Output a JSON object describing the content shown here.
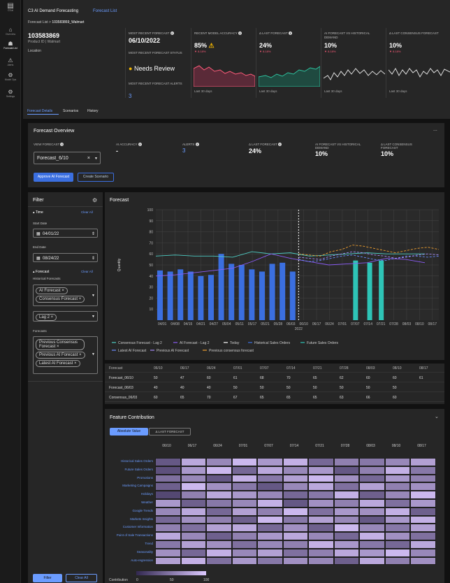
{
  "app": {
    "logo_text": "C3.ai",
    "title": "C3 AI Demand Forecasting",
    "tab_link": "Forecast List"
  },
  "nav": [
    {
      "label": "Overview",
      "icon": "home-icon",
      "glyph": "⌂"
    },
    {
      "label": "Forecast List",
      "icon": "people-icon",
      "glyph": "☗"
    },
    {
      "label": "Alerts",
      "icon": "alert-icon",
      "glyph": "⚠"
    },
    {
      "label": "Model Ops",
      "icon": "gear-icon",
      "glyph": "⚙"
    },
    {
      "label": "Settings",
      "icon": "gear-icon",
      "glyph": "⚙"
    }
  ],
  "breadcrumb": {
    "parent": "Forecast List",
    "separator": ">",
    "current": "103583869_Walmart"
  },
  "product": {
    "id": "103583869",
    "sub": "Product ID | Walmart",
    "location_label": "Location"
  },
  "metrics": {
    "recent_forecast_label": "MOST RECENT FORECAST",
    "recent_forecast_value": "06/10/2022",
    "status_label": "MOST RECENT FORECAST STATUS",
    "status_value": "Needs Review",
    "alerts_label": "MOST RECENT FORECAST ALERTS",
    "alerts_value": "3",
    "accuracy_label": "RECENT MODEL ACCURACY",
    "accuracy_value": "85%",
    "accuracy_delta": "▼ 8.18%",
    "delta_last_label": "Δ LAST FORECAST",
    "delta_last_value": "24%",
    "delta_last_delta": "▼ 8.18%",
    "vs_hist_label": "AI FORECAST VS HISTORICAL DEMAND",
    "vs_hist_value": "10%",
    "vs_hist_delta": "▼ 8.18%",
    "consensus_label": "Δ LAST CONSENSUS FORECAST",
    "consensus_value": "10%",
    "consensus_delta": "▼ 8.18%",
    "spark_caption": "Last 30 days"
  },
  "tabs": [
    "Forecast Details",
    "Scenarios",
    "History"
  ],
  "overview": {
    "title": "Forecast Overview",
    "menu": "...",
    "view_label": "VIEW FORECAST",
    "view_value": "Forecast_6/10",
    "clear": "×",
    "cols": [
      {
        "label": "AI ACCURACY",
        "value": "-"
      },
      {
        "label": "ALERTS",
        "value": "3"
      },
      {
        "label": "Δ LAST FORECAST",
        "value": "24%"
      },
      {
        "label": "AI FORECAST VS HISTORICAL DEMAND",
        "value": "10%"
      },
      {
        "label": "Δ LAST CONSENSUS FORECAST",
        "value": "10%"
      }
    ],
    "approve": "Approve AI Forecast",
    "create": "Create Scenario"
  },
  "filter": {
    "title": "Filter",
    "time_label": "Time",
    "clear_all": "Clear All",
    "start_label": "Start Date",
    "start_value": "04/01/22",
    "end_label": "End Date",
    "end_value": "08/24/22",
    "forecast_label": "Forecast",
    "hist_label": "Historical Forecasts",
    "hist_chips": [
      "AI Forecast ×",
      "Consensus Forecast ×"
    ],
    "lag_chip": "Lag 2 ×",
    "forecasts_label": "Forecasts",
    "forecast_chips": [
      "Previous Consensus Forecast ×",
      "Previous AI Forecast ×",
      "Latest AI Forecast ×"
    ],
    "filter_btn": "Filter",
    "clear_btn": "Clear All"
  },
  "chart_data": {
    "type": "bar",
    "title": "Forecast",
    "ylabel": "Quantity",
    "ylim": [
      0,
      100
    ],
    "yticks": [
      10,
      20,
      30,
      40,
      50,
      60,
      70,
      80,
      90,
      100
    ],
    "x_ticks": [
      "04/01",
      "04/08",
      "04/15",
      "04/21",
      "04/27",
      "05/04",
      "05/11",
      "05/17",
      "05/21",
      "05/28",
      "06/03",
      "06/10",
      "06/17",
      "06/24",
      "07/01",
      "07/07",
      "07/14",
      "07/21",
      "07/28",
      "08/03",
      "08/10",
      "08/17"
    ],
    "today_label": "2022",
    "historical_sales": [
      45,
      44,
      46,
      44,
      40,
      41,
      60,
      51,
      50,
      46,
      44,
      51,
      52,
      44
    ],
    "future_sales": [
      {
        "x": "07/07",
        "value": 54
      },
      {
        "x": "07/17",
        "value": 52
      },
      {
        "x": "07/21",
        "value": 54
      }
    ],
    "consensus_lag2": [
      58,
      59,
      58,
      58,
      57,
      62,
      60,
      61,
      58,
      59,
      60,
      61,
      60,
      60,
      60
    ],
    "ai_lag2": [
      40,
      41,
      43,
      45,
      47,
      53,
      60,
      56,
      53,
      50,
      51,
      52,
      56,
      55,
      52
    ],
    "latest_ai": [
      55,
      53,
      54,
      56,
      58,
      59,
      57,
      55,
      54,
      56,
      58,
      58,
      57,
      58
    ],
    "previous_ai": [
      57,
      56,
      55,
      58,
      60,
      62,
      61,
      59,
      58,
      56,
      57,
      59,
      60,
      59
    ],
    "previous_consensus": [
      60,
      59,
      58,
      62,
      64,
      68,
      67,
      65,
      63,
      61,
      63,
      65,
      66,
      64
    ],
    "legend": [
      "Consensus Forecast - Lag 2",
      "AI Forecast - Lag 2",
      "Today",
      "Historical Sales Orders",
      "Future Sales Orders",
      "Latest AI Forecast",
      "Previous AI Forecast",
      "Previous consensus forecast"
    ],
    "colors": {
      "consensus": "#4ecdc4",
      "ai": "#8b5cf6",
      "hist": "#3b6fe0",
      "future": "#2ec4b6",
      "latest": "#6b8cff",
      "prev_ai": "#a78bfa",
      "prev_cons": "#f0a030"
    }
  },
  "table": {
    "header": [
      "Forecast",
      "06/10",
      "06/17",
      "06/24",
      "07/01",
      "07/07",
      "07/14",
      "07/21",
      "07/28",
      "08/03",
      "08/10",
      "08/17"
    ],
    "rows": [
      [
        "Forecast_06/10",
        "50",
        "47",
        "60",
        "61",
        "68",
        "70",
        "65",
        "62",
        "60",
        "60",
        "61"
      ],
      [
        "Forecast_06/03",
        "40",
        "40",
        "40",
        "50",
        "50",
        "50",
        "50",
        "50",
        "50",
        "50",
        ""
      ],
      [
        "Consensus_06/03",
        "60",
        "65",
        "70",
        "67",
        "65",
        "65",
        "65",
        "63",
        "66",
        "60",
        ""
      ]
    ]
  },
  "features": {
    "title": "Feature Contribution",
    "tab_abs": "Absolute Value",
    "tab_delta": "Δ LAST FORECAST",
    "cols": [
      "06/10",
      "06/17",
      "06/24",
      "07/01",
      "07/07",
      "07/14",
      "07/21",
      "07/28",
      "08/03",
      "08/10",
      "08/17"
    ],
    "rows": [
      "Historical Sales Orders",
      "Future Sales Orders",
      "Promotions",
      "Marketing Campaigns",
      "Holidays",
      "Weather",
      "Google Trends",
      "Markets Insights",
      "Customer Information",
      "Point of Sale Transactions",
      "Trend",
      "Seasonality",
      "Auto-regression"
    ],
    "values": [
      [
        30,
        80,
        60,
        90,
        70,
        85,
        40,
        55,
        50,
        60,
        75
      ],
      [
        25,
        70,
        90,
        40,
        80,
        60,
        70,
        30,
        55,
        85,
        50
      ],
      [
        45,
        60,
        30,
        85,
        50,
        75,
        90,
        65,
        40,
        70,
        55
      ],
      [
        35,
        90,
        65,
        50,
        30,
        60,
        80,
        45,
        75,
        55,
        65
      ],
      [
        20,
        55,
        80,
        70,
        60,
        40,
        50,
        85,
        35,
        60,
        90
      ],
      [
        70,
        35,
        50,
        60,
        85,
        30,
        65,
        55,
        80,
        45,
        70
      ],
      [
        60,
        80,
        40,
        75,
        55,
        90,
        45,
        70,
        65,
        85,
        35
      ],
      [
        40,
        65,
        55,
        35,
        90,
        50,
        75,
        60,
        30,
        70,
        85
      ],
      [
        55,
        45,
        75,
        80,
        40,
        65,
        35,
        90,
        60,
        50,
        75
      ],
      [
        80,
        60,
        35,
        55,
        70,
        80,
        60,
        40,
        85,
        65,
        45
      ],
      [
        50,
        75,
        65,
        45,
        60,
        55,
        85,
        70,
        50,
        40,
        80
      ],
      [
        65,
        40,
        85,
        60,
        75,
        45,
        55,
        80,
        70,
        90,
        60
      ],
      [
        75,
        85,
        45,
        70,
        50,
        65,
        60,
        35,
        80,
        55,
        65
      ]
    ],
    "legend_label": "Contribution",
    "legend_ticks": [
      "0",
      "50",
      "100"
    ],
    "collapse": "⌄"
  }
}
